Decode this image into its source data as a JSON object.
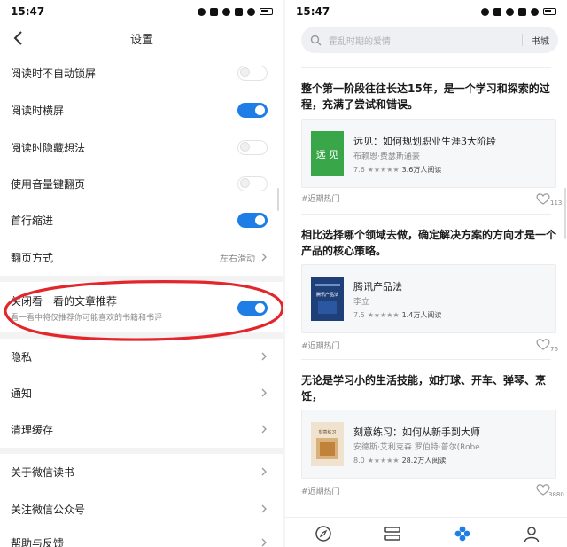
{
  "left": {
    "status_time": "15:47",
    "title": "设置",
    "rows": [
      {
        "label": "阅读时不自动锁屏"
      },
      {
        "label": "阅读时横屏"
      },
      {
        "label": "阅读时隐藏想法"
      },
      {
        "label": "使用音量键翻页"
      },
      {
        "label": "首行缩进"
      },
      {
        "label": "翻页方式",
        "value": "左右滑动"
      },
      {
        "label": "关闭看一看的文章推荐",
        "sublabel": "看一看中将仅推荐你可能喜欢的书籍和书评"
      },
      {
        "label": "隐私"
      },
      {
        "label": "通知"
      },
      {
        "label": "清理缓存"
      },
      {
        "label": "关于微信读书"
      },
      {
        "label": "关注微信公众号"
      },
      {
        "label": "帮助与反馈"
      }
    ],
    "toggles": {
      "auto_lock": false,
      "landscape": true,
      "hide_thoughts": false,
      "volume_keys": false,
      "indent": true,
      "close_recommend": true
    },
    "annotation_color": "#e3262b",
    "accent": "#1e7ee6"
  },
  "right": {
    "status_time": "15:47",
    "search": {
      "placeholder": "霍乱时期的爱情",
      "store_label": "书城"
    },
    "posts": [
      {
        "title": "整个第一阶段往往长达15年，是一个学习和探索的过程，充满了尝试和错误。",
        "book": {
          "name": "远见：如何规划职业生涯3大阶段",
          "author": "布赖恩·费瑟斯通豪",
          "rating": "7.6",
          "stars": "★★★★★",
          "readers": "3.6万人阅读",
          "cover_text": "远 见",
          "cover_color": "#3aa64a"
        },
        "tag": "#近期热门",
        "likes": "113"
      },
      {
        "title": "相比选择哪个领域去做，确定解决方案的方向才是一个产品的核心策略。",
        "book": {
          "name": "腾讯产品法",
          "author": "李立",
          "rating": "7.5",
          "stars": "★★★★★",
          "readers": "1.4万人阅读",
          "cover_text": "腾讯产品法",
          "cover_color": "#1f3f78"
        },
        "tag": "#近期热门",
        "likes": "76"
      },
      {
        "title": "无论是学习小的生活技能，如打球、开车、弹琴、烹饪，",
        "book": {
          "name": "刻意练习：如何从新手到大师",
          "author": "安德斯·艾利克森 罗伯特·普尔(Robe",
          "rating": "8.0",
          "stars": "★★★★★",
          "readers": "28.2万人阅读",
          "cover_text": "刻意练习",
          "cover_color": "#efe3cf"
        },
        "tag": "#近期热门",
        "likes": "3880"
      }
    ],
    "nav": [
      {
        "label": "",
        "icon": "compass-icon",
        "active": false
      },
      {
        "label": "",
        "icon": "bookshelf-icon",
        "active": false
      },
      {
        "label": "",
        "icon": "flower-icon",
        "active": true
      },
      {
        "label": "",
        "icon": "profile-icon",
        "active": false
      }
    ]
  }
}
